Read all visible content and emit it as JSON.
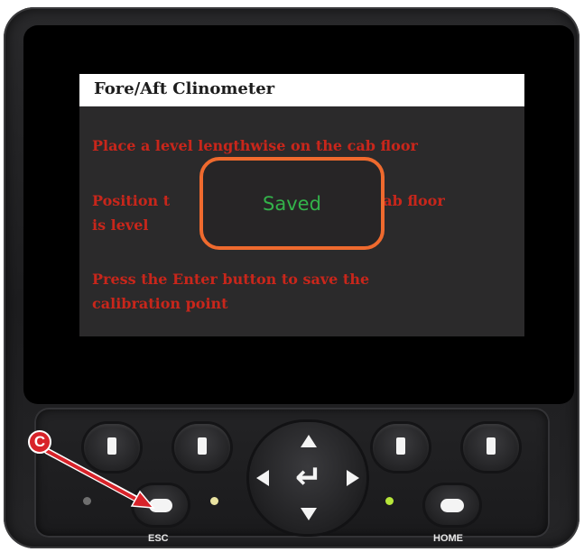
{
  "screen": {
    "title": "Fore/Aft Clinometer",
    "instructions": [
      "Place a level lengthwise on the cab floor",
      "Position t",
      "he cab floor",
      "is level",
      "Press the Enter button to save the",
      "calibration point"
    ],
    "popup_text": "Saved"
  },
  "keypad": {
    "esc_label": "ESC",
    "home_label": "HOME",
    "leds": {
      "left_color": "#6f6f6f",
      "esc_color": "#e9e2a0",
      "home_color": "#b7e63a"
    }
  },
  "callout": {
    "label": "C",
    "color": "#d8232a"
  },
  "colors": {
    "screen_bg": "#2b2a2b",
    "instruction_text": "#c8261b",
    "popup_border": "#ef6a2e",
    "popup_text": "#33b24a"
  },
  "icons": {
    "dpad_up": "triangle-up",
    "dpad_down": "triangle-down",
    "dpad_left": "triangle-left",
    "dpad_right": "triangle-right",
    "enter": "return-arrow"
  }
}
